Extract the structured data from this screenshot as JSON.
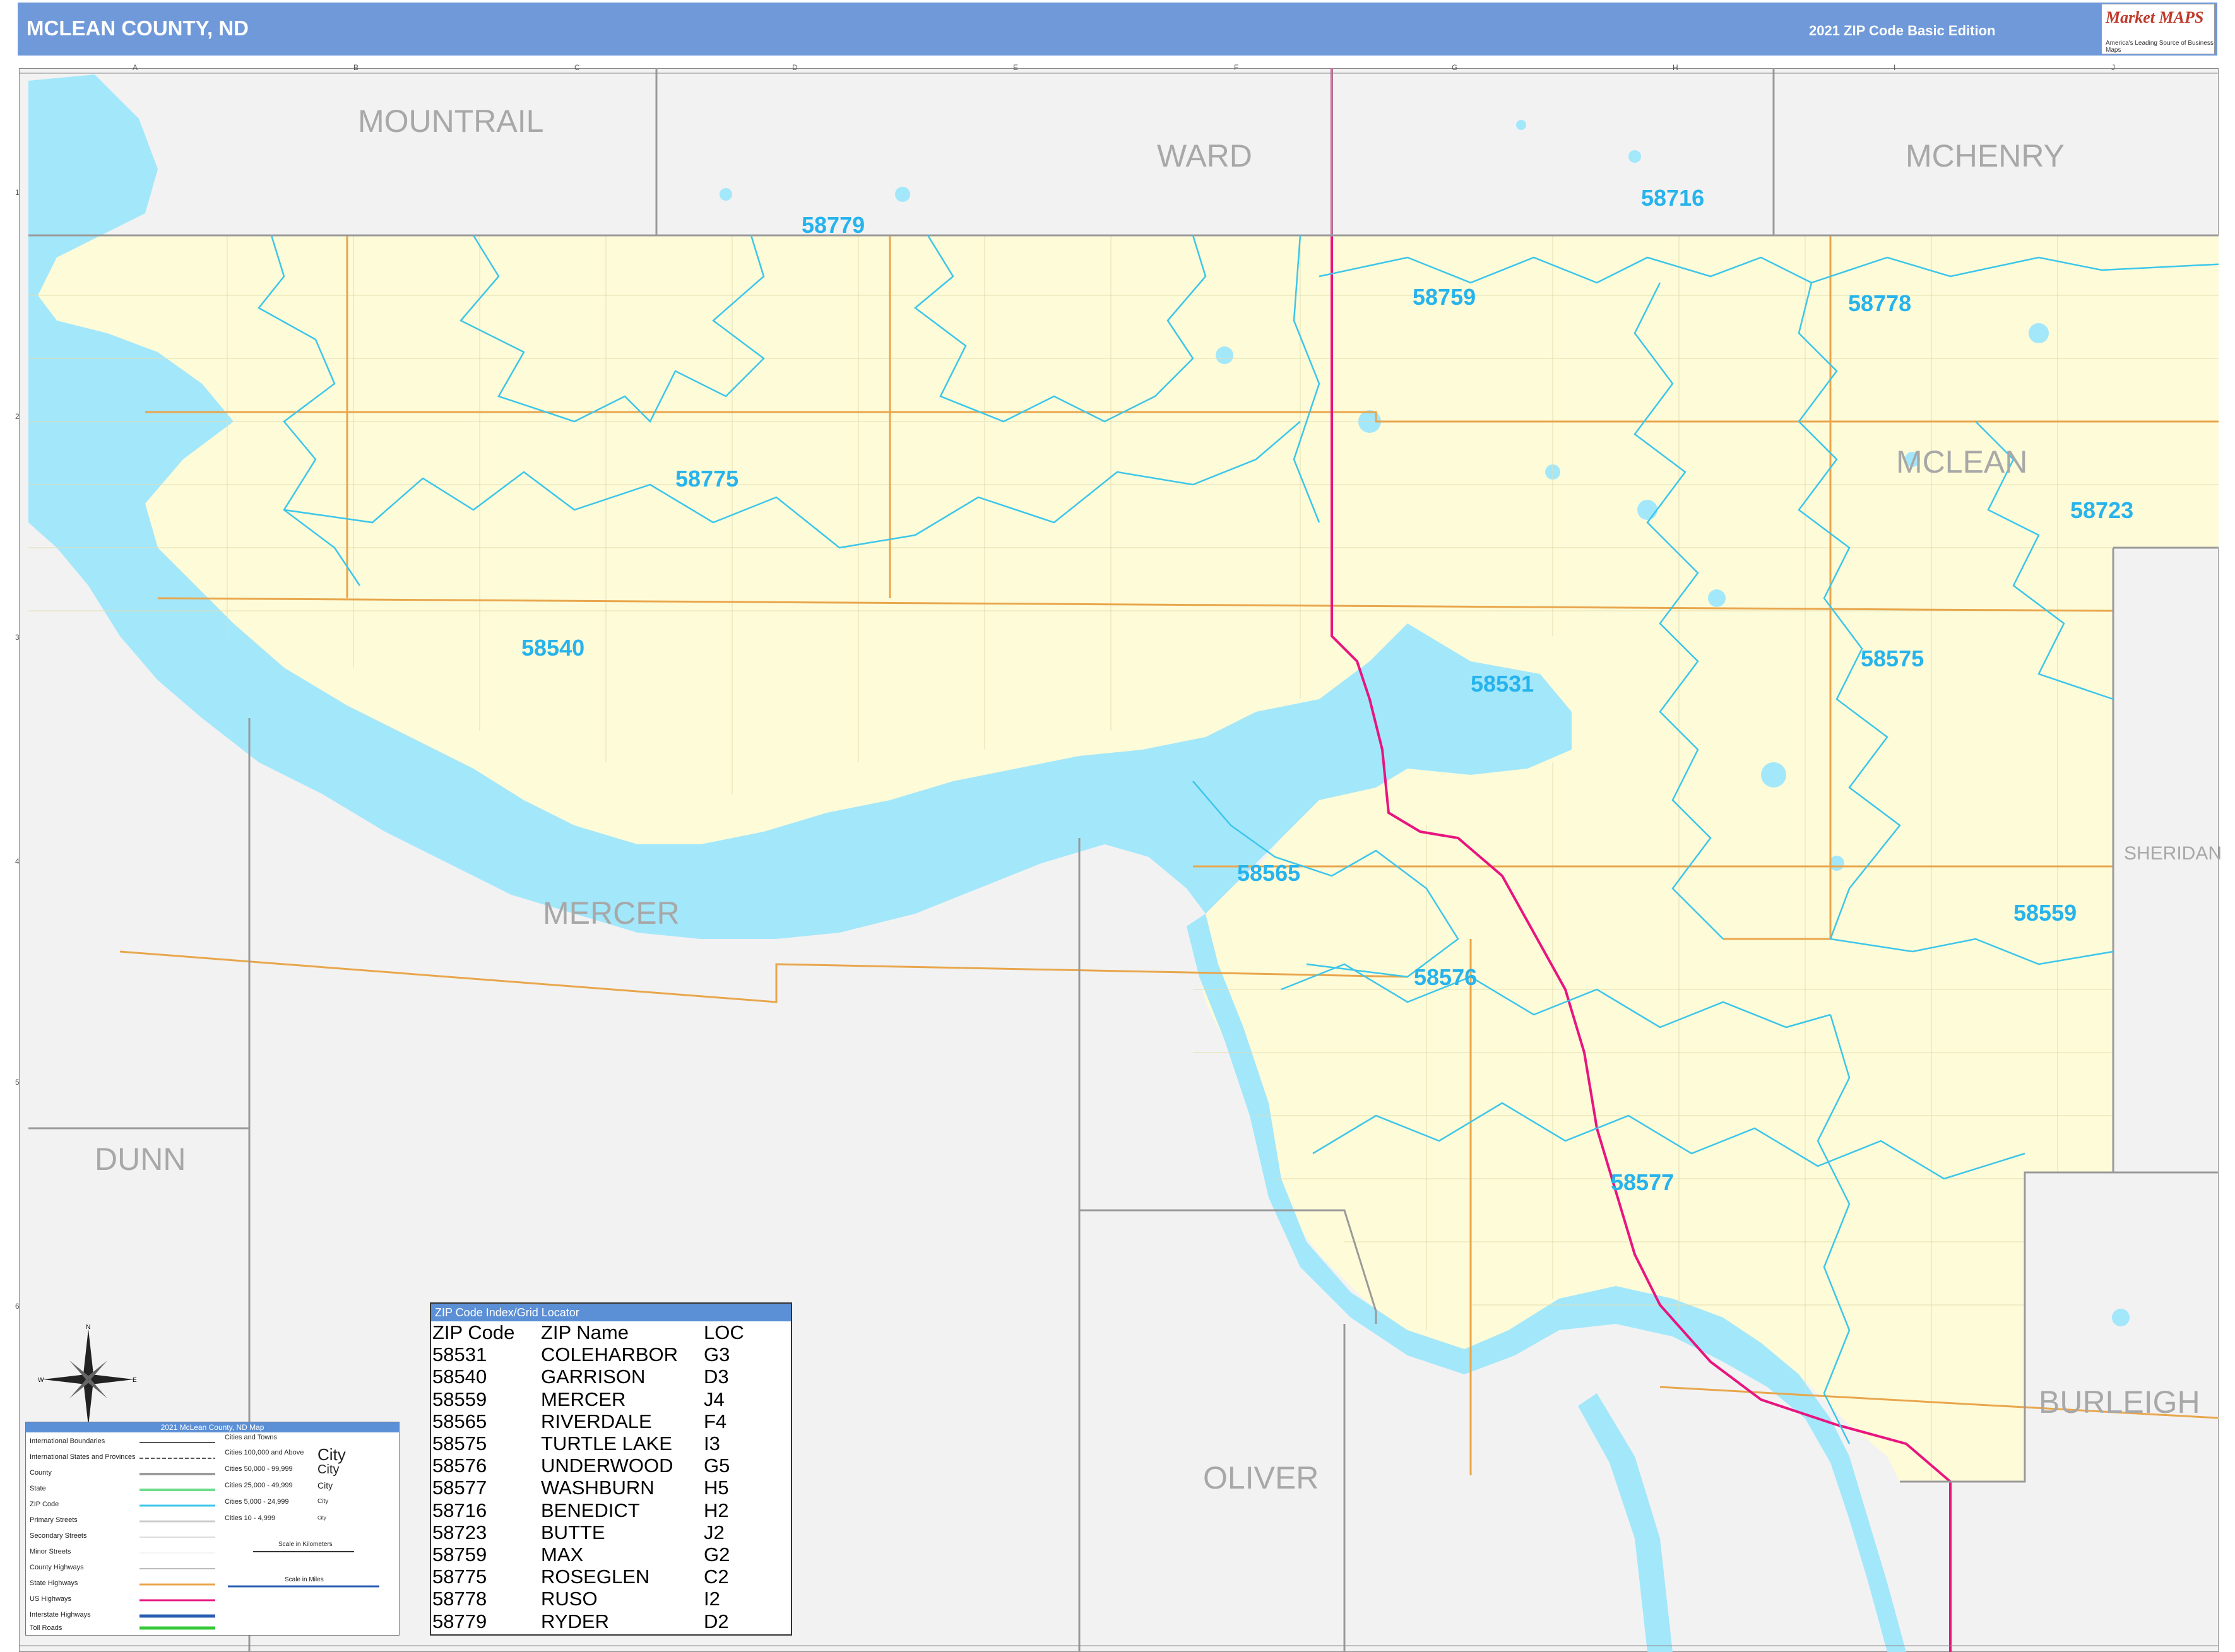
{
  "header": {
    "title": "MCLEAN COUNTY, ND",
    "edition": "2021 ZIP Code Basic Edition",
    "logo_brand": "Market MAPS",
    "logo_tag": "America's Leading Source of Business Maps"
  },
  "counties": [
    {
      "name": "MOUNTRAIL",
      "id": "mountrail"
    },
    {
      "name": "WARD",
      "id": "ward"
    },
    {
      "name": "MCHENRY",
      "id": "mchenry"
    },
    {
      "name": "MCLEAN",
      "id": "mclean"
    },
    {
      "name": "SHERIDAN",
      "id": "sheridan"
    },
    {
      "name": "MERCER",
      "id": "mercer"
    },
    {
      "name": "DUNN",
      "id": "dunn"
    },
    {
      "name": "OLIVER",
      "id": "oliver"
    },
    {
      "name": "BURLEIGH",
      "id": "burleigh"
    }
  ],
  "zips": [
    "58779",
    "58716",
    "58759",
    "58778",
    "58775",
    "58723",
    "58540",
    "58531",
    "58575",
    "58565",
    "58559",
    "58576",
    "58577"
  ],
  "locator": {
    "title": "ZIP Code Index/Grid Locator",
    "columns": [
      "ZIP Code",
      "ZIP Name",
      "LOC"
    ],
    "rows": [
      [
        "58531",
        "COLEHARBOR",
        "G3"
      ],
      [
        "58540",
        "GARRISON",
        "D3"
      ],
      [
        "58559",
        "MERCER",
        "J4"
      ],
      [
        "58565",
        "RIVERDALE",
        "F4"
      ],
      [
        "58575",
        "TURTLE LAKE",
        "I3"
      ],
      [
        "58576",
        "UNDERWOOD",
        "G5"
      ],
      [
        "58577",
        "WASHBURN",
        "H5"
      ],
      [
        "58716",
        "BENEDICT",
        "H2"
      ],
      [
        "58723",
        "BUTTE",
        "J2"
      ],
      [
        "58759",
        "MAX",
        "G2"
      ],
      [
        "58775",
        "ROSEGLEN",
        "C2"
      ],
      [
        "58778",
        "RUSO",
        "I2"
      ],
      [
        "58779",
        "RYDER",
        "D2"
      ]
    ]
  },
  "legend": {
    "title": "2021 McLean County, ND Map",
    "left_items": [
      "International Boundaries",
      "International States and Provinces",
      "County",
      "State",
      "ZIP Code",
      "Primary Streets",
      "Secondary Streets",
      "Minor Streets",
      "County Highways",
      "State Highways",
      "US Highways",
      "Interstate Highways",
      "Toll Roads"
    ],
    "cities_title": "Cities and Towns",
    "city_items": [
      {
        "label": "Cities 100,000 and Above",
        "sample": "City"
      },
      {
        "label": "Cities 50,000 - 99,999",
        "sample": "City"
      },
      {
        "label": "Cities 25,000 - 49,999",
        "sample": "City"
      },
      {
        "label": "Cities 5,000 - 24,999",
        "sample": "City"
      },
      {
        "label": "Cities 10 - 4,999",
        "sample": "City"
      }
    ],
    "scale_km": "Scale in Kilometers",
    "scale_mi": "Scale in Miles"
  },
  "grid": {
    "cols": [
      "A",
      "B",
      "C",
      "D",
      "E",
      "F",
      "G",
      "H",
      "I",
      "J"
    ],
    "rows": [
      "1",
      "2",
      "3",
      "4",
      "5",
      "6"
    ]
  },
  "colors": {
    "header": "#6f99d9",
    "water": "#a3e7fb",
    "county_fill": "#fefbd8",
    "outside": "#f2f2f2",
    "zip_line": "#3cc6ea",
    "us_hwy": "#e8157f"
  }
}
